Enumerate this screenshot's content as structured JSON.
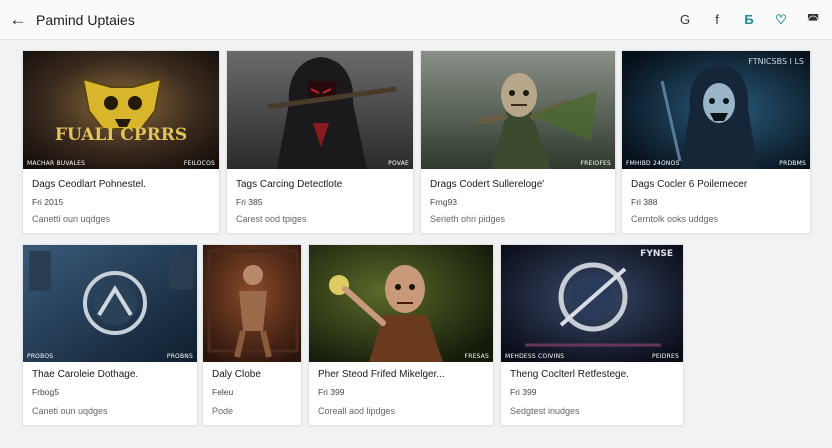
{
  "header": {
    "title": "Pamind Uptaies",
    "back_icon": "arrow-left-icon",
    "actions": [
      {
        "icon": "refresh-icon",
        "glyph": "G"
      },
      {
        "icon": "facebook-icon",
        "glyph": "f"
      },
      {
        "icon": "twitter-icon",
        "glyph": "Ƃ"
      },
      {
        "icon": "heart-icon",
        "glyph": "♡"
      },
      {
        "icon": "chat-icon",
        "glyph": "◚"
      }
    ]
  },
  "colors": {
    "accent": "#178a9a",
    "background": "#f1f2f3"
  },
  "cards": [
    {
      "title": "Dags Ceodlart Pohnestel.",
      "price": "Fri 2015",
      "status": "Canetti oun uqdges",
      "art_text": "FUALI CPRRS",
      "cap_left": "MACHAR BUVALES",
      "cap_right": "FEILOCOS"
    },
    {
      "title": "Tags Carcing Detectlote",
      "price": "Fri 385",
      "status": "Carest ood tpiges",
      "cap_left": "",
      "cap_right": "POVAE"
    },
    {
      "title": "Drags Codert Sullereloge'",
      "price": "Frng93",
      "status": "Serieth ohri pidges",
      "cap_left": "",
      "cap_right": "FREIOFES"
    },
    {
      "title": "Dags Cocler 6 Poilemecer",
      "price": "Fri 388",
      "status": "Cerntolk ooks uddges",
      "art_text": "FTNICSBS I LS",
      "cap_left": "FMHIBD 24ONOS",
      "cap_right": "PRDBMS"
    },
    {
      "title": "Thae Caroleie Dothage.",
      "price": "Frbog5",
      "status": "Caneti oun uqdges",
      "cap_left": "PROBOS",
      "cap_right": "PROBNS"
    },
    {
      "title": "Daly Clobe",
      "price": "Feleu",
      "status": "Pode",
      "cap_left": "",
      "cap_right": ""
    },
    {
      "title": "Pher Steod Frifed Mikelger...",
      "price": "Fri 399",
      "status": "Coreall aod lipdges",
      "cap_left": "",
      "cap_right": "FRESAS"
    },
    {
      "title": "Theng Coclterl Retfestege.",
      "price": "Fri 399",
      "status": "Sedgtest inudges",
      "art_text": "FYNSE",
      "cap_left": "MEHDESS COIVINS",
      "cap_right": "PEIDRES"
    }
  ]
}
